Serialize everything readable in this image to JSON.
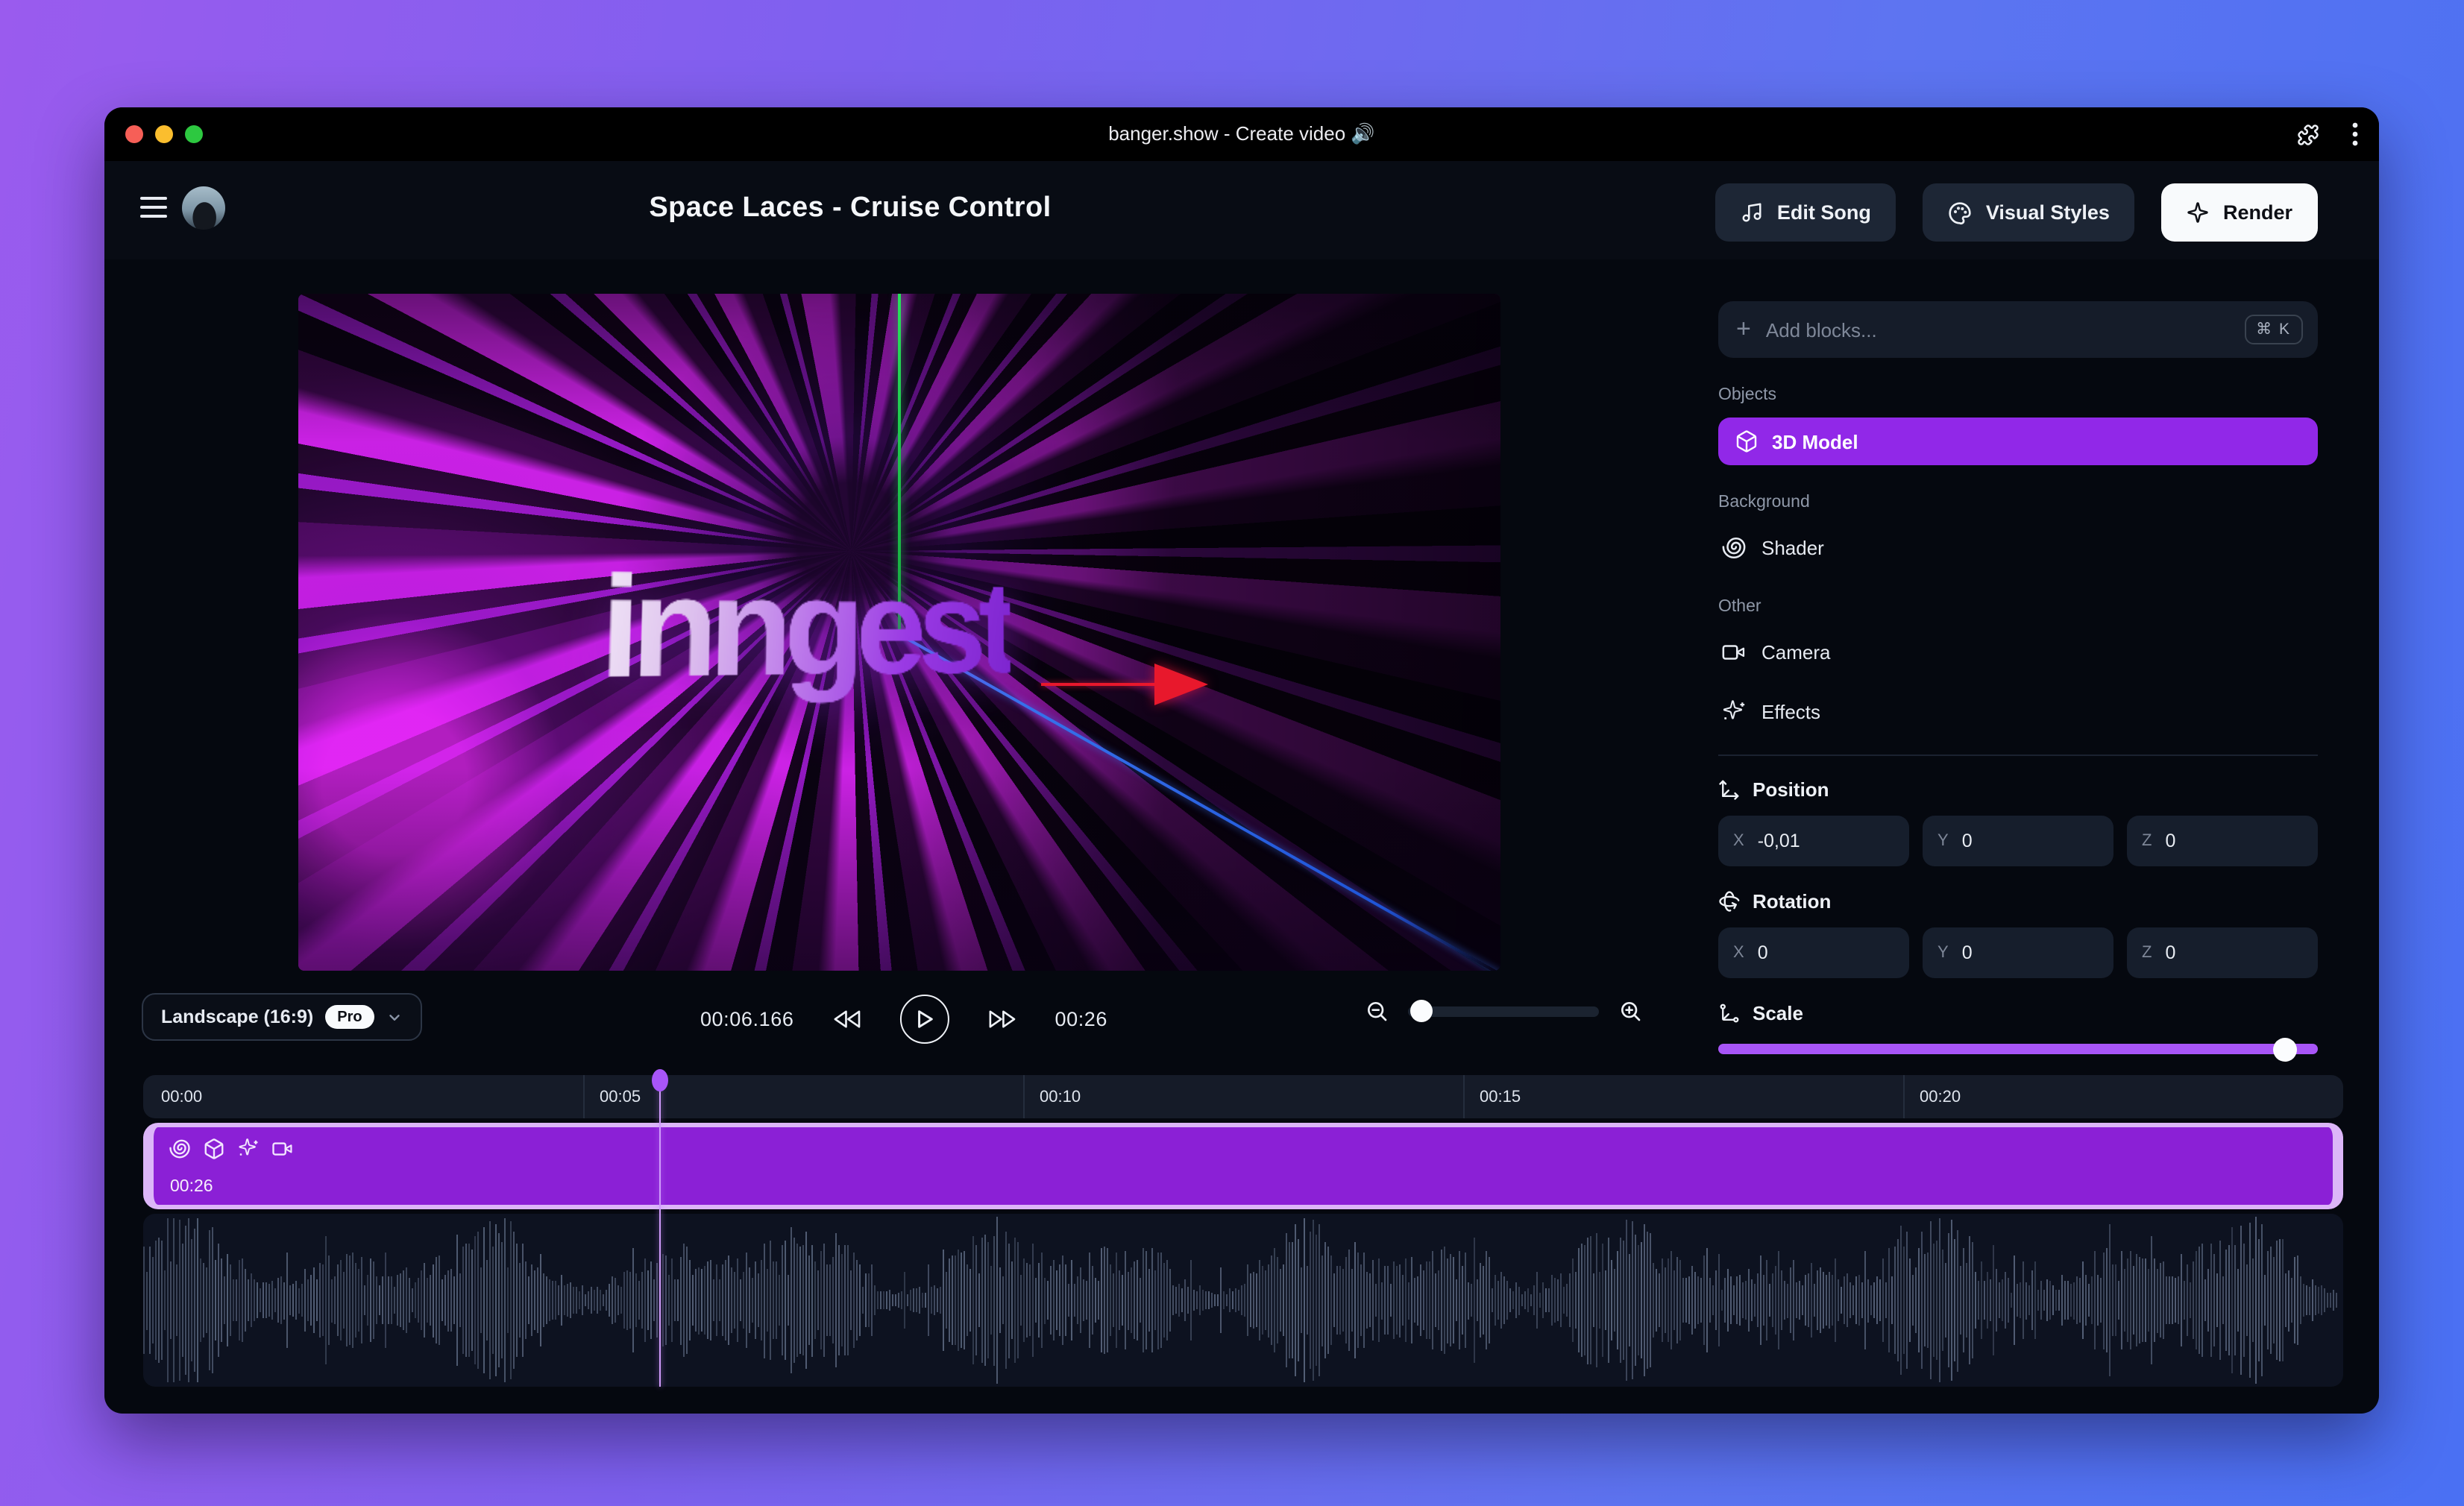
{
  "window": {
    "title": "banger.show - Create video 🔊"
  },
  "header": {
    "song_title": "Space Laces - Cruise Control",
    "edit_song_label": "Edit Song",
    "visual_styles_label": "Visual Styles",
    "render_label": "Render"
  },
  "panel": {
    "add_blocks_placeholder": "Add blocks...",
    "shortcut": "⌘ K",
    "sections": {
      "objects": "Objects",
      "background": "Background",
      "other": "Other"
    },
    "model_label": "3D Model",
    "shader_label": "Shader",
    "camera_label": "Camera",
    "effects_label": "Effects",
    "axes": {
      "x": "X",
      "y": "Y",
      "z": "Z"
    },
    "position": {
      "label": "Position",
      "x": "-0,01",
      "y": "0",
      "z": "0"
    },
    "rotation": {
      "label": "Rotation",
      "x": "0",
      "y": "0",
      "z": "0"
    },
    "scale": {
      "label": "Scale",
      "thumb_pct": 94.5
    }
  },
  "preview": {
    "brand_text": "inngest",
    "gizmo_axes": [
      "x-axis-red",
      "y-axis-green",
      "z-axis-blue"
    ]
  },
  "transport": {
    "aspect_label": "Landscape (16:9)",
    "pro_badge": "Pro",
    "current_time": "00:06.166",
    "total_duration": "00:26",
    "zoom_pct": 7
  },
  "timeline": {
    "ticks": [
      "00:00",
      "00:05",
      "00:10",
      "00:15",
      "00:20"
    ],
    "clip_duration": "00:26",
    "clip_icons": [
      "shader-icon",
      "3d-model-icon",
      "effects-icon",
      "camera-icon"
    ],
    "playhead_pct": 23.5
  },
  "colors": {
    "accent_purple": "#9128e8",
    "clip_purple": "#8b20d6",
    "clip_border": "#dcb6f8",
    "playhead": "#a855f7",
    "render_button": "#f8fafc"
  }
}
